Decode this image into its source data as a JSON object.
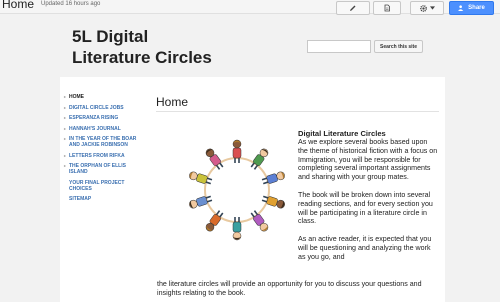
{
  "topbar": {
    "page_name": "Home",
    "updated": "Updated 16 hours ago",
    "share_label": "Share"
  },
  "header": {
    "title_line1": "5L Digital",
    "title_line2": "Literature Circles",
    "search_placeholder": "",
    "search_button": "Search this site"
  },
  "sidebar": {
    "items": [
      {
        "label": "HOME",
        "active": true
      },
      {
        "label": "Digital Circle Jobs"
      },
      {
        "label": "Esperanza Rising"
      },
      {
        "label": "Hannah's Journal"
      },
      {
        "label": "In the Year of the Boar and Jackie Robinson"
      },
      {
        "label": "Letters from Rifka"
      },
      {
        "label": "The Orphan of Ellis Island"
      },
      {
        "label": "Your Final Project Choices"
      },
      {
        "label": "Sitemap"
      }
    ]
  },
  "main": {
    "page_title": "Home",
    "section_heading": "Digital Literature Circles",
    "para1": "As we explore several books based upon the theme of historical fiction with a focus on Immigration, you will be responsible for completing several important assignments and sharing with your group mates.",
    "para2": "The book will be broken down into several reading sections, and for every section you will be participating in a literature circle in class.",
    "para3_start": "As an active reader, it is expected that you will be questioning and analyzing the work as you go, and",
    "para3_end": "the literature circles will provide an opportunity for you to discuss your questions and insights relating to the book."
  },
  "colors": {
    "link": "#3a6fb0",
    "share": "#4d90fe"
  }
}
